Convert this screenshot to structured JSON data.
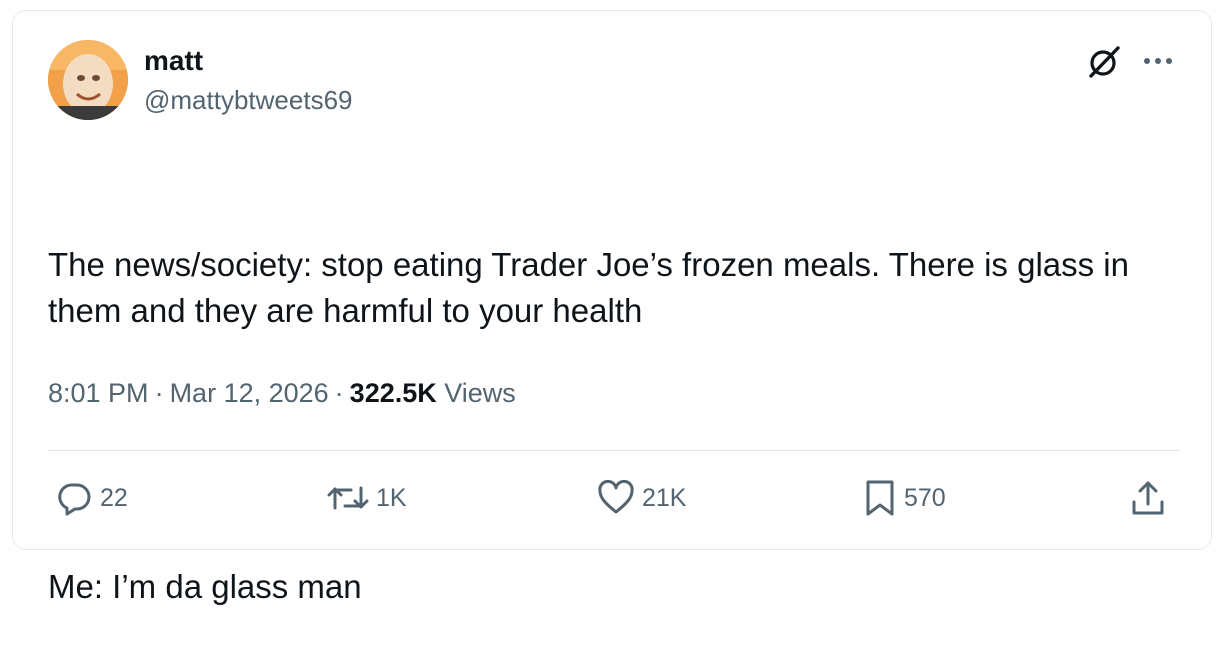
{
  "author": {
    "display_name": "matt",
    "handle": "@mattybtweets69"
  },
  "tweet": {
    "lines": [
      "The news/society: stop eating Trader Joe’s frozen meals. There is glass in them and they are harmful to your health",
      "Me: I’m da glass man"
    ],
    "time": "8:01 PM",
    "date": "Mar 12, 2026",
    "separator": "·",
    "views_count": "322.5K",
    "views_label": "Views"
  },
  "actions": {
    "replies": "22",
    "reposts": "1K",
    "likes": "21K",
    "bookmarks": "570"
  },
  "icons": {
    "grok": "grok-icon",
    "more": "more-icon",
    "reply": "reply-icon",
    "repost": "repost-icon",
    "like": "heart-icon",
    "bookmark": "bookmark-icon",
    "share": "share-icon"
  },
  "colors": {
    "text": "#0f1419",
    "secondary": "#536471",
    "border": "#e1e6ea"
  }
}
